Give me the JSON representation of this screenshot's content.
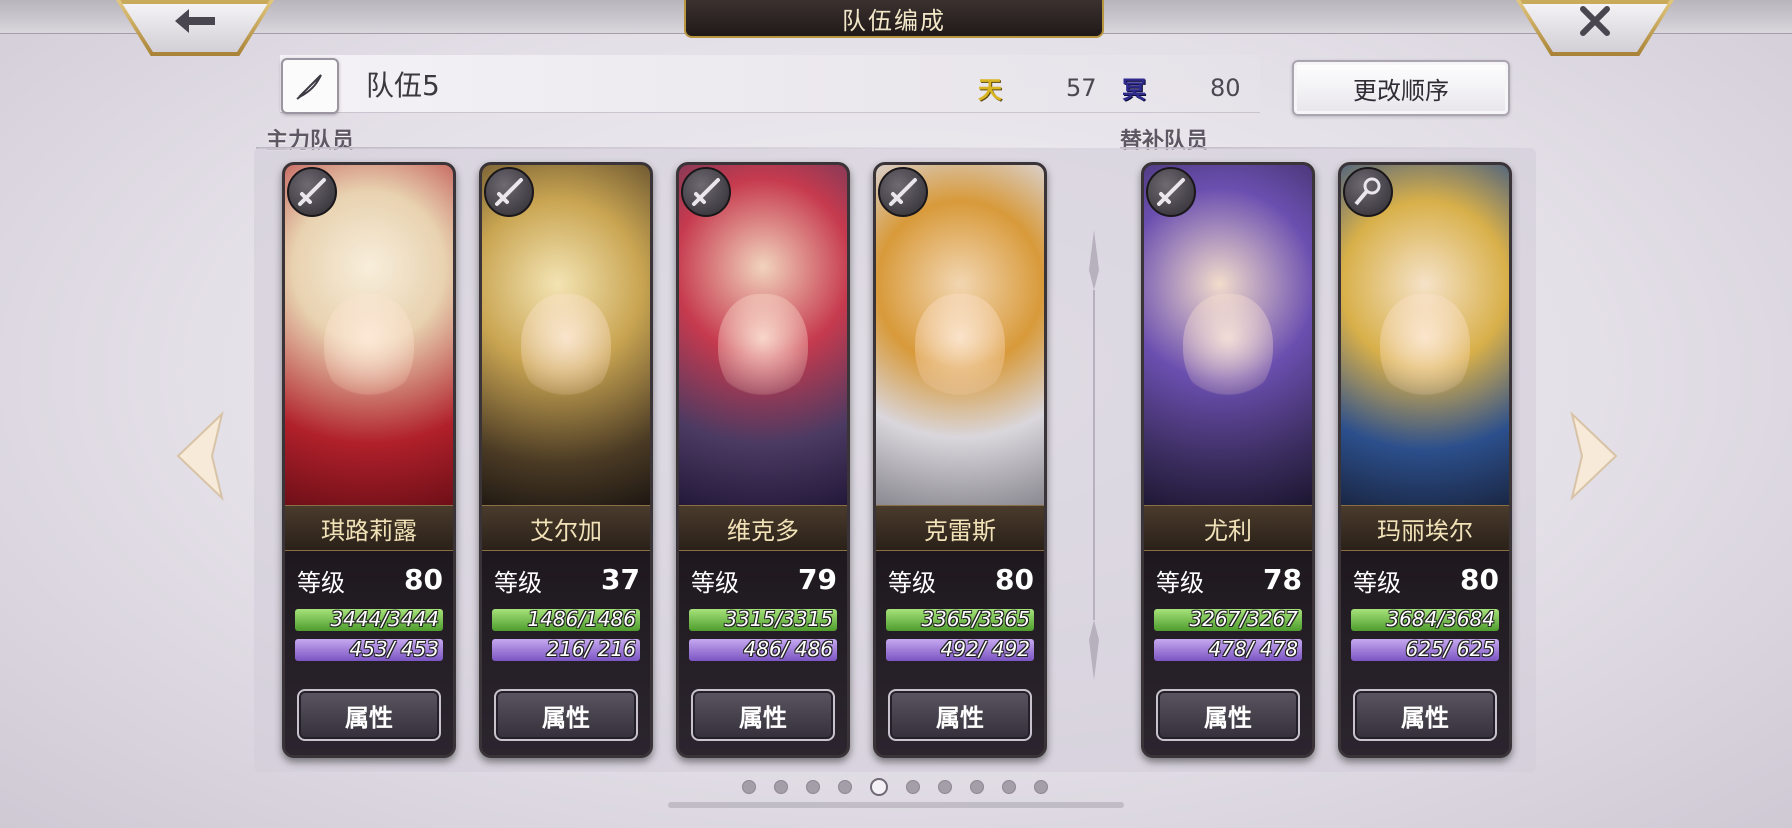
{
  "header": {
    "title": "队伍编成",
    "back_icon": "back-arrow-icon",
    "close_icon": "close-icon"
  },
  "team": {
    "name": "队伍5",
    "sky_badge": "天",
    "sky_value": "57",
    "dark_badge": "冥",
    "dark_value": "80",
    "reorder_label": "更改顺序"
  },
  "sections": {
    "main_label": "主力队员",
    "sub_label": "替补队员"
  },
  "colors": {
    "accent_gold": "#b8953f",
    "hp_green": "#4e9d2d",
    "mp_purple": "#7b55c2"
  },
  "members": [
    {
      "name": "琪路莉露",
      "level_label": "等级",
      "level": "80",
      "hp": "3444/3444",
      "mp": "453/ 453",
      "attr_label": "属性",
      "weapon_icon": "sword-icon"
    },
    {
      "name": "艾尔加",
      "level_label": "等级",
      "level": "37",
      "hp": "1486/1486",
      "mp": "216/ 216",
      "attr_label": "属性",
      "weapon_icon": "sword-icon"
    },
    {
      "name": "维克多",
      "level_label": "等级",
      "level": "79",
      "hp": "3315/3315",
      "mp": "486/ 486",
      "attr_label": "属性",
      "weapon_icon": "sword-icon"
    },
    {
      "name": "克雷斯",
      "level_label": "等级",
      "level": "80",
      "hp": "3365/3365",
      "mp": "492/ 492",
      "attr_label": "属性",
      "weapon_icon": "sword-icon"
    }
  ],
  "reserves": [
    {
      "name": "尤利",
      "level_label": "等级",
      "level": "78",
      "hp": "3267/3267",
      "mp": "478/ 478",
      "attr_label": "属性",
      "weapon_icon": "sword-icon"
    },
    {
      "name": "玛丽埃尔",
      "level_label": "等级",
      "level": "80",
      "hp": "3684/3684",
      "mp": "625/ 625",
      "attr_label": "属性",
      "weapon_icon": "staff-icon"
    }
  ],
  "pagination": {
    "total": 10,
    "current": 5
  }
}
